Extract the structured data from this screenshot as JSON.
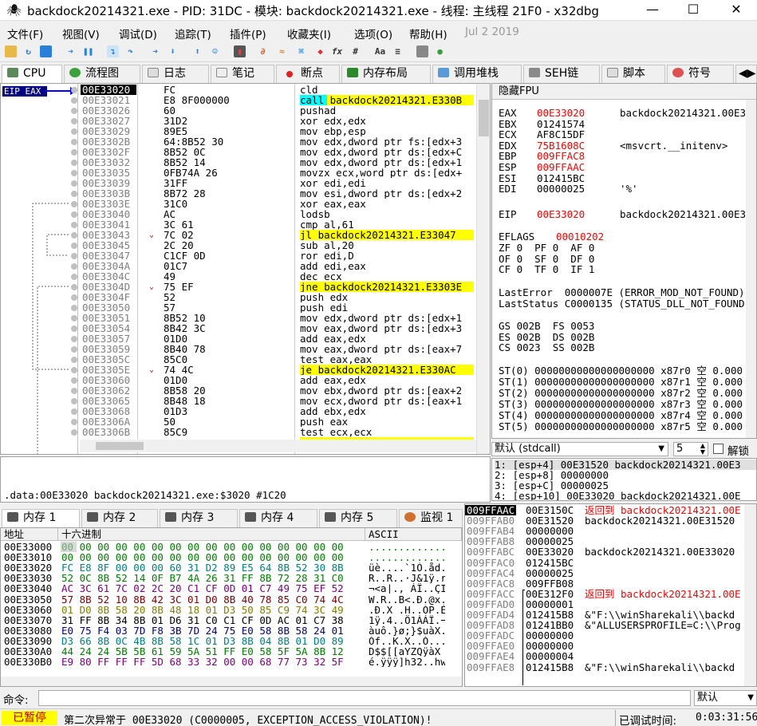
{
  "window": {
    "title": "backdock20214321.exe - PID: 31DC - 模块: backdock20214321.exe - 线程: 主线程 21F0 - x32dbg",
    "min": "—",
    "max": "☐",
    "close": "✕"
  },
  "menu": [
    "文件(F)",
    "视图(V)",
    "调试(D)",
    "追踪(T)",
    "插件(P)",
    "收藏夹(I)",
    "选项(O)",
    "帮助(H)",
    "Jul 2 2019"
  ],
  "tabs": [
    "CPU",
    "流程图",
    "日志",
    "笔记",
    "断点",
    "内存布局",
    "调用堆栈",
    "SEH链",
    "脚本",
    "符号"
  ],
  "eip_label": "EIP EAX",
  "disasm": [
    {
      "addr": "00E33020",
      "bytes": "FC",
      "ins": "cld",
      "cur": true
    },
    {
      "addr": "00E33021",
      "bytes": "E8 8F000000",
      "ins": "call backdock20214321.E330B"
    },
    {
      "addr": "00E33026",
      "bytes": "60",
      "ins": "pushad"
    },
    {
      "addr": "00E33027",
      "bytes": "31D2",
      "ins": "xor edx,edx"
    },
    {
      "addr": "00E33029",
      "bytes": "89E5",
      "ins": "mov ebp,esp"
    },
    {
      "addr": "00E3302B",
      "bytes": "64:8B52 30",
      "ins": "mov edx,dword ptr fs:[edx+3"
    },
    {
      "addr": "00E3302F",
      "bytes": "8B52 0C",
      "ins": "mov edx,dword ptr ds:[edx+C"
    },
    {
      "addr": "00E33032",
      "bytes": "8B52 14",
      "ins": "mov edx,dword ptr ds:[edx+1"
    },
    {
      "addr": "00E33035",
      "bytes": "0FB74A 26",
      "ins": "movzx ecx,word ptr ds:[edx+"
    },
    {
      "addr": "00E33039",
      "bytes": "31FF",
      "ins": "xor edi,edi"
    },
    {
      "addr": "00E3303B",
      "bytes": "8B72 28",
      "ins": "mov esi,dword ptr ds:[edx+2"
    },
    {
      "addr": "00E3303E",
      "bytes": "31C0",
      "ins": "xor eax,eax"
    },
    {
      "addr": "00E33040",
      "bytes": "AC",
      "ins": "lodsb"
    },
    {
      "addr": "00E33041",
      "bytes": "3C 61",
      "ins": "cmp al,61"
    },
    {
      "addr": "00E33043",
      "bytes": "7C 02",
      "ins": "jl backdock20214321.E33047",
      "arrow": true
    },
    {
      "addr": "00E33045",
      "bytes": "2C 20",
      "ins": "sub al,20"
    },
    {
      "addr": "00E33047",
      "bytes": "C1CF 0D",
      "ins": "ror edi,D"
    },
    {
      "addr": "00E3304A",
      "bytes": "01C7",
      "ins": "add edi,eax"
    },
    {
      "addr": "00E3304C",
      "bytes": "49",
      "ins": "dec ecx"
    },
    {
      "addr": "00E3304D",
      "bytes": "75 EF",
      "ins": "jne backdock20214321.E3303E",
      "arrow": true
    },
    {
      "addr": "00E3304F",
      "bytes": "52",
      "ins": "push edx"
    },
    {
      "addr": "00E33050",
      "bytes": "57",
      "ins": "push edi"
    },
    {
      "addr": "00E33051",
      "bytes": "8B52 10",
      "ins": "mov edx,dword ptr ds:[edx+1"
    },
    {
      "addr": "00E33054",
      "bytes": "8B42 3C",
      "ins": "mov eax,dword ptr ds:[edx+3"
    },
    {
      "addr": "00E33057",
      "bytes": "01D0",
      "ins": "add eax,edx"
    },
    {
      "addr": "00E33059",
      "bytes": "8B40 78",
      "ins": "mov eax,dword ptr ds:[eax+7"
    },
    {
      "addr": "00E3305C",
      "bytes": "85C0",
      "ins": "test eax,eax"
    },
    {
      "addr": "00E3305E",
      "bytes": "74 4C",
      "ins": "je backdock20214321.E330AC",
      "arrow": true
    },
    {
      "addr": "00E33060",
      "bytes": "01D0",
      "ins": "add eax,edx"
    },
    {
      "addr": "00E33062",
      "bytes": "8B58 20",
      "ins": "mov ebx,dword ptr ds:[eax+2"
    },
    {
      "addr": "00E33065",
      "bytes": "8B48 18",
      "ins": "mov ecx,dword ptr ds:[eax+1"
    },
    {
      "addr": "00E33068",
      "bytes": "01D3",
      "ins": "add ebx,edx"
    },
    {
      "addr": "00E3306A",
      "bytes": "50",
      "ins": "push eax"
    },
    {
      "addr": "00E3306B",
      "bytes": "85C9",
      "ins": "test ecx,ecx"
    }
  ],
  "regs_title": "隐藏FPU",
  "regs": [
    {
      "n": "EAX",
      "v": "00E33020",
      "c": "backdock20214321.00E3",
      "red": true
    },
    {
      "n": "EBX",
      "v": "01241574",
      "c": ""
    },
    {
      "n": "ECX",
      "v": "AF8C15DF",
      "c": ""
    },
    {
      "n": "EDX",
      "v": "75B1608C",
      "c": "<msvcrt.__initenv>",
      "red": true
    },
    {
      "n": "EBP",
      "v": "009FFAC8",
      "c": "",
      "red": true
    },
    {
      "n": "ESP",
      "v": "009FFAAC",
      "c": "",
      "red": true
    },
    {
      "n": "ESI",
      "v": "012415BC",
      "c": ""
    },
    {
      "n": "EDI",
      "v": "00000025",
      "c": "'%'"
    }
  ],
  "eip": {
    "n": "EIP",
    "v": "00E33020",
    "c": "backdock20214321.00E3"
  },
  "eflags": {
    "label": "EFLAGS",
    "v": "00010202"
  },
  "flags": [
    "ZF 0  PF 0  AF 0",
    "OF 0  SF 0  DF 0",
    "CF 0  TF 0  IF 1"
  ],
  "lasterror": "LastError  0000007E (ERROR_MOD_NOT_FOUND)",
  "laststatus": "LastStatus C0000135 (STATUS_DLL_NOT_FOUND)",
  "segs": [
    "GS 002B  FS 0053",
    "ES 002B  DS 002B",
    "CS 0023  SS 002B"
  ],
  "fpu": [
    "ST(0) 00000000000000000000 x87r0 空 0.000",
    "ST(1) 00000000000000000000 x87r1 空 0.000",
    "ST(2) 00000000000000000000 x87r2 空 0.000",
    "ST(3) 00000000000000000000 x87r3 空 0.000",
    "ST(4) 00000000000000000000 x87r4 空 0.000",
    "ST(5) 00000000000000000000 x87r5 空 0.000"
  ],
  "callconv": {
    "value": "默认 (stdcall)",
    "num": "5",
    "unlock": "解锁"
  },
  "callstack": [
    "1: [esp+4] 00E31520 backdock20214321.00E3",
    "2: [esp+8] 00000000",
    "3: [esp+C] 00000025",
    "4: [esp+10] 00E33020 backdock20214321.00E"
  ],
  "infoline": ".data:00E33020 backdock20214321.exe:$3020 #1C20",
  "memtabs": [
    "内存 1",
    "内存 2",
    "内存 3",
    "内存 4",
    "内存 5",
    "监视 1"
  ],
  "dumphdr": {
    "addr": "地址",
    "hex": "十六进制",
    "ascii": "ASCII"
  },
  "dump": [
    {
      "a": "00E33000",
      "h": "00 00 00 00 00 00 00 00 00 00 00 00 00 00 00 00",
      "s": "................"
    },
    {
      "a": "00E33010",
      "h": "00 00 00 00 00 00 00 00 00 00 00 00 00 00 00 00",
      "s": "................"
    },
    {
      "a": "00E33020",
      "h": "FC E8 8F 00 00 00 60 31 D2 89 E5 64 8B 52 30 8B",
      "s": "üè....`1Ò.åd.R0."
    },
    {
      "a": "00E33030",
      "h": "52 0C 8B 52 14 0F B7 4A 26 31 FF 8B 72 28 31 C0",
      "s": "R..R..·J&1ÿ.r(1À"
    },
    {
      "a": "00E33040",
      "h": "AC 3C 61 7C 02 2C 20 C1 CF 0D 01 C7 49 75 EF 52",
      "s": "¬<a|., ÁÏ..ÇIuïR"
    },
    {
      "a": "00E33050",
      "h": "57 8B 52 10 8B 42 3C 01 D0 8B 40 78 85 C0 74 4C",
      "s": "W.R..B<.Ð.@x.ÀtL"
    },
    {
      "a": "00E33060",
      "h": "01 D0 8B 58 20 8B 48 18 01 D3 50 85 C9 74 3C 49",
      "s": ".Ð.X .H..ÓP.Ét<I"
    },
    {
      "a": "00E33070",
      "h": "31 FF 8B 34 8B 01 D6 31 C0 C1 CF 0D AC 01 C7 38",
      "s": "1ÿ.4..Ö1ÀÁÏ.¬.Ç8"
    },
    {
      "a": "00E33080",
      "h": "E0 75 F4 03 7D F8 3B 7D 24 75 E0 58 8B 58 24 01",
      "s": "àuô.}ø;}$uàX.X$."
    },
    {
      "a": "00E33090",
      "h": "D3 66 8B 0C 4B 8B 58 1C 01 D3 8B 04 8B 01 D0 89",
      "s": "Óf..K.X..Ó....Ð."
    },
    {
      "a": "00E330A0",
      "h": "44 24 24 5B 5B 61 59 5A 51 FF E0 58 5F 5A 8B 12",
      "s": "D$$[[aYZQÿàX_Z.."
    },
    {
      "a": "00E330B0",
      "h": "E9 80 FF FF FF 5D 68 33 32 00 00 68 77 73 32 5F",
      "s": "é.ÿÿÿ]h32..hws2_"
    }
  ],
  "stack": [
    {
      "a": "009FFAAC",
      "v": "00E3150C",
      "c": "返回到 backdock20214321.00E",
      "cur": true,
      "red": true
    },
    {
      "a": "009FFAB0",
      "v": "00E31520",
      "c": "backdock20214321.00E31520"
    },
    {
      "a": "009FFAB4",
      "v": "00000000",
      "c": ""
    },
    {
      "a": "009FFAB8",
      "v": "00000025",
      "c": ""
    },
    {
      "a": "009FFABC",
      "v": "00E33020",
      "c": "backdock20214321.00E33020"
    },
    {
      "a": "009FFAC0",
      "v": "012415BC",
      "c": ""
    },
    {
      "a": "009FFAC4",
      "v": "00000025",
      "c": ""
    },
    {
      "a": "009FFAC8",
      "v": "009FFB08",
      "c": ""
    },
    {
      "a": "009FFACC",
      "v": "00E312F0",
      "c": "返回到 backdock20214321.00E",
      "red": true
    },
    {
      "a": "009FFAD0",
      "v": "00000001",
      "c": ""
    },
    {
      "a": "009FFAD4",
      "v": "012415B8",
      "c": "&\"F:\\\\winSharekali\\\\backd"
    },
    {
      "a": "009FFAD8",
      "v": "01241BB0",
      "c": "&\"ALLUSERSPROFILE=C:\\\\Prog"
    },
    {
      "a": "009FFADC",
      "v": "00000000",
      "c": ""
    },
    {
      "a": "009FFAE0",
      "v": "00000000",
      "c": ""
    },
    {
      "a": "009FFAE4",
      "v": "00000004",
      "c": ""
    },
    {
      "a": "009FFAE8",
      "v": "012415B8",
      "c": "&\"F:\\\\winSharekali\\\\backd"
    }
  ],
  "cmd": {
    "label": "命令:",
    "value": "",
    "mode": "默认"
  },
  "status": {
    "state": "已暂停",
    "msg": "第二次异常于 00E33020 (C0000005, EXCEPTION_ACCESS_VIOLATION)!",
    "time_label": "已调试时间:",
    "time": "0:03:31:56"
  },
  "colors": {
    "highlight": "#ffff00",
    "call": "#00ffff",
    "eip_bg": "#000080",
    "paused": "#ffff00",
    "reg_changed": "#ff0000"
  }
}
